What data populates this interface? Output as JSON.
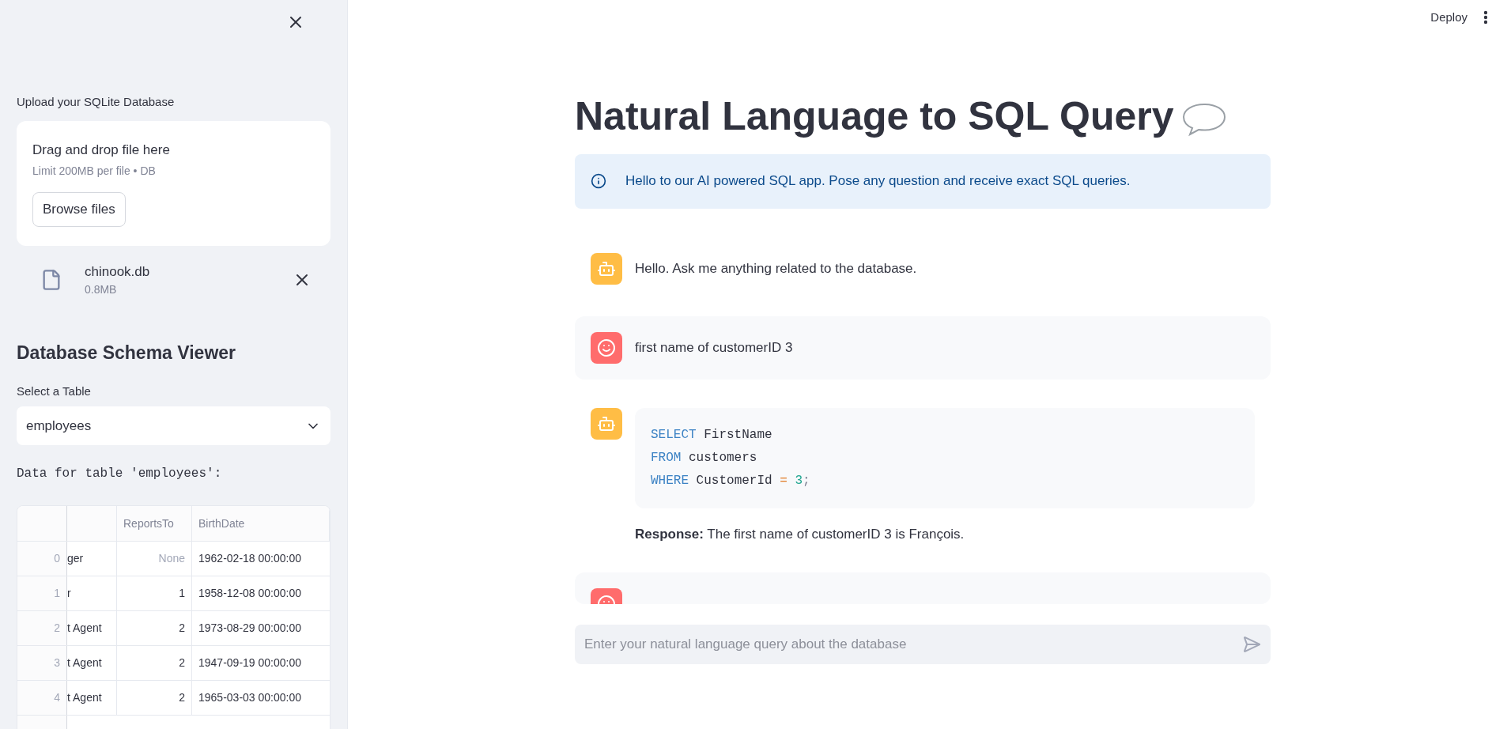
{
  "sidebar": {
    "upload_label": "Upload your SQLite Database",
    "dropzone": {
      "title": "Drag and drop file here",
      "hint": "Limit 200MB per file • DB",
      "button": "Browse files"
    },
    "file": {
      "name": "chinook.db",
      "size": "0.8MB"
    },
    "schema_title": "Database Schema Viewer",
    "select": {
      "label": "Select a Table",
      "value": "employees"
    },
    "table_caption": "Data for table 'employees':",
    "table": {
      "columns": [
        "ReportsTo",
        "BirthDate"
      ],
      "rows": [
        {
          "index": "0",
          "column_1": "ger",
          "reports_to": "None",
          "reports_to_null": true,
          "birth_date": "1962-02-18 00:00:00"
        },
        {
          "index": "1",
          "column_1": "r",
          "reports_to": "1",
          "reports_to_null": false,
          "birth_date": "1958-12-08 00:00:00"
        },
        {
          "index": "2",
          "column_1": "t Agent",
          "reports_to": "2",
          "reports_to_null": false,
          "birth_date": "1973-08-29 00:00:00"
        },
        {
          "index": "3",
          "column_1": "t Agent",
          "reports_to": "2",
          "reports_to_null": false,
          "birth_date": "1947-09-19 00:00:00"
        },
        {
          "index": "4",
          "column_1": "t Agent",
          "reports_to": "2",
          "reports_to_null": false,
          "birth_date": "1965-03-03 00:00:00"
        }
      ]
    }
  },
  "header": {
    "deploy": "Deploy"
  },
  "title": "Natural Language to SQL Query",
  "info": "Hello to our AI powered SQL app. Pose any question and receive exact SQL queries.",
  "messages": [
    {
      "kind": "assistant_text",
      "text": "Hello. Ask me anything related to the database."
    },
    {
      "kind": "user_text",
      "text": "first name of customerID 3"
    },
    {
      "kind": "assistant_code",
      "code_lines": [
        [
          {
            "kind": "keyword",
            "text": "SELECT"
          },
          {
            "kind": "plain",
            "text": " FirstName"
          }
        ],
        [
          {
            "kind": "keyword",
            "text": "FROM"
          },
          {
            "kind": "plain",
            "text": " customers"
          }
        ],
        [
          {
            "kind": "keyword",
            "text": "WHERE"
          },
          {
            "kind": "plain",
            "text": " CustomerId "
          },
          {
            "kind": "operator",
            "text": "= "
          },
          {
            "kind": "number",
            "text": "3"
          },
          {
            "kind": "punct",
            "text": ";"
          }
        ]
      ],
      "response": "**Response:** The first name of customerID 3 is François."
    },
    {
      "kind": "user_clipped"
    }
  ],
  "chat_input": {
    "placeholder": "Enter your natural language query about the database"
  }
}
